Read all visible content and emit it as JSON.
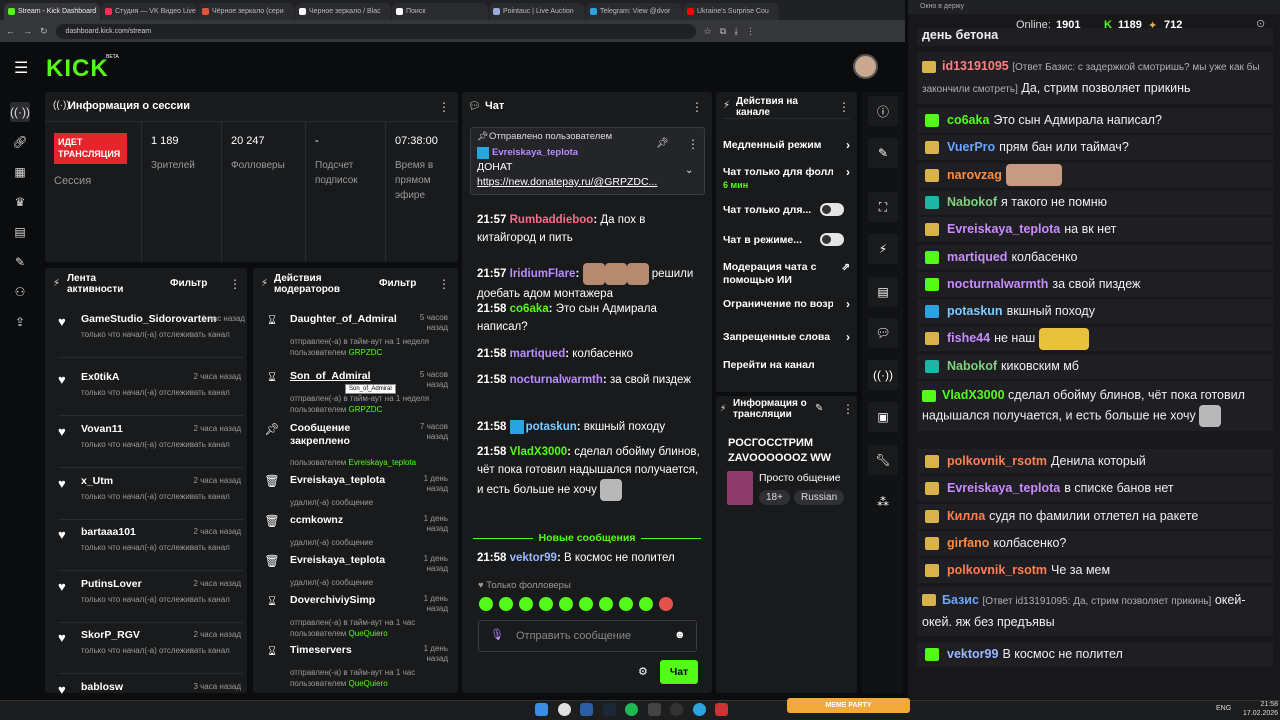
{
  "browser": {
    "tabs": [
      "Stream - Kick Dashboard",
      "Студия — VK Видео Live",
      "Чёрное зеркало (сери",
      "Черное зеркало / Blac",
      "Поиск",
      "Pointauc | Live Auction",
      "Telegram: View @dvor",
      "Ukraine's Surprise Cou"
    ],
    "url": "dashboard.kick.com/stream"
  },
  "header": {
    "logo": "KICK",
    "beta": "BETA"
  },
  "session": {
    "title": "Информация о сессии",
    "live_badge": "ИДЕТ ТРАНСЛЯЦИЯ",
    "session_label": "Сессия",
    "viewers_value": "1 189",
    "viewers_label": "Зрителей",
    "followers_value": "20 247",
    "followers_label": "Фолловеры",
    "subs_value": "-",
    "subs_label": "Подсчет подписок",
    "uptime_value": "07:38:00",
    "uptime_label": "Время в прямом эфире"
  },
  "activity": {
    "title": "Лента активности",
    "filter": "Фильтр",
    "items": [
      {
        "name": "GameStudio_Sidorovartem",
        "time": "1 час назад",
        "desc": "только что начал(-а) отслеживать канал"
      },
      {
        "name": "Ex0tikA",
        "time": "2 часа назад",
        "desc": "только что начал(-а) отслеживать канал"
      },
      {
        "name": "Vovan11",
        "time": "2 часа назад",
        "desc": "только что начал(-а) отслеживать канал"
      },
      {
        "name": "x_Utm",
        "time": "2 часа назад",
        "desc": "только что начал(-а) отслеживать канал"
      },
      {
        "name": "bartaaa101",
        "time": "2 часа назад",
        "desc": "только что начал(-а) отслеживать канал"
      },
      {
        "name": "PutinsLover",
        "time": "2 часа назад",
        "desc": "только что начал(-а) отслеживать канал"
      },
      {
        "name": "SkorP_RGV",
        "time": "2 часа назад",
        "desc": "только что начал(-а) отслеживать канал"
      },
      {
        "name": "bablosw",
        "time": "3 часа назад",
        "desc": ""
      }
    ]
  },
  "mod": {
    "title": "Действия модераторов",
    "filter": "Фильтр",
    "tooltip": "Son_of_Admiral",
    "items": [
      {
        "name": "Daughter_of_Admiral",
        "time": "5 часов назад",
        "desc": "отправлен(-а) в тайм-аут на 1 неделя пользователем",
        "by": "GRPZDC"
      },
      {
        "name": "Son_of_Admiral",
        "time": "5 часов назад",
        "desc": "отправлен(-а) в тайм-аут на 1 неделя пользователем",
        "by": "GRPZDC"
      },
      {
        "name": "Сообщение закреплено",
        "time": "7 часов назад",
        "desc": "пользователем",
        "by": "Evreiskaya_teplota"
      },
      {
        "name": "Evreiskaya_teplota",
        "time": "1 день назад",
        "desc": "удалил(-а) сообщение",
        "by": ""
      },
      {
        "name": "ccmkownz",
        "time": "1 день назад",
        "desc": "удалил(-а) сообщение",
        "by": ""
      },
      {
        "name": "Evreiskaya_teplota",
        "time": "1 день назад",
        "desc": "удалил(-а) сообщение",
        "by": ""
      },
      {
        "name": "DoverchiviySimp",
        "time": "1 день назад",
        "desc": "отправлен(-а) в тайм-аут на 1 час пользователем",
        "by": "QueQuiero"
      },
      {
        "name": "Timeservers",
        "time": "1 день назад",
        "desc": "отправлен(-а) в тайм-аут на 1 час пользователем",
        "by": "QueQuiero"
      }
    ]
  },
  "chat": {
    "title": "Чат",
    "pinned_label": "Отправлено пользователем",
    "pinned_user": "Evreiskaya_teplota",
    "pinned_text": "ДОНАТ",
    "pinned_link": "https://new.donatepay.ru/@GRPZDC...",
    "new_messages": "Новые сообщения",
    "followers_only": "Только фолловеры",
    "input_placeholder": "Отправить сообщение",
    "send": "Чат",
    "messages": [
      {
        "time": "21:57",
        "user": "Rumbaddieboo",
        "color": "#ff6b8a",
        "text": "Да пох в китайгород и пить"
      },
      {
        "time": "21:57",
        "user": "IridiumFlare",
        "color": "#b98cff",
        "text": "решили доебать адом монтажера"
      },
      {
        "time": "21:58",
        "user": "со6aka",
        "color": "#53fc18",
        "text": "Это сын Адмирала написал?"
      },
      {
        "time": "21:58",
        "user": "martiqued",
        "color": "#b98cff",
        "text": "колбасенко"
      },
      {
        "time": "21:58",
        "user": "nocturnalwarmth",
        "color": "#b98cff",
        "text": "за свой пиздеж"
      },
      {
        "time": "21:58",
        "user": "potaskun",
        "color": "#7ecbff",
        "text": "вкшный походу"
      },
      {
        "time": "21:58",
        "user": "VladX3000",
        "color": "#53fc18",
        "text": "сделал обойму блинов, чёт пока готовил надышался получается, и есть больше не хочу"
      },
      {
        "time": "21:58",
        "user": "vektor99",
        "color": "#9ab8ff",
        "text": "В космос не полител"
      }
    ]
  },
  "actions": {
    "title": "Действия на канале",
    "items": [
      {
        "label": "Медленный режим"
      },
      {
        "label": "Чат только для фолл",
        "sub": "6 мин"
      },
      {
        "label": "Чат только для..."
      },
      {
        "label": "Чат в режиме..."
      },
      {
        "label": "Модерация чата с помощью ИИ"
      },
      {
        "label": "Ограничение по возр"
      },
      {
        "label": "Запрещенные слова"
      },
      {
        "label": "Перейти на канал"
      }
    ]
  },
  "stream_info": {
    "title": "Информация о трансляции",
    "stream_title": "РОСГОССТРИМ ZAVOOOOOOZ WW",
    "category": "Просто общение",
    "age": "18+",
    "language": "Russian"
  },
  "twitch": {
    "window_title": "Окно в держу",
    "online_label": "Online:",
    "online_value": "1901",
    "kick_count": "1189",
    "twitch_count": "712",
    "top_text": "день бетона",
    "messages": [
      {
        "user": "id13191095",
        "color": "#ff7f7f",
        "reply": "[Ответ Базис: с задержкой смотришь? мы уже как бы закончили смотреть]",
        "text": "Да, стрим позволяет прикинь"
      },
      {
        "user": "со6aka",
        "color": "#53fc18",
        "text": "Это сын Адмирала написал?"
      },
      {
        "user": "VuerPro",
        "color": "#6aa6ff",
        "text": "прям бан или таймач?"
      },
      {
        "user": "narovzag",
        "color": "#ff8c3a",
        "text": ""
      },
      {
        "user": "Nabokof",
        "color": "#7fd27f",
        "text": "я такого не помню"
      },
      {
        "user": "Evreiskaya_teplota",
        "color": "#c98cff",
        "text": "на вк нет"
      },
      {
        "user": "martiqued",
        "color": "#c98cff",
        "text": "колбасенко"
      },
      {
        "user": "nocturnalwarmth",
        "color": "#c98cff",
        "text": "за свой пиздеж"
      },
      {
        "user": "potaskun",
        "color": "#7ecbff",
        "text": "вкшный походу"
      },
      {
        "user": "fishe44",
        "color": "#c98cff",
        "text": "не наш"
      },
      {
        "user": "Nabokof",
        "color": "#7fd27f",
        "text": "киковским мб"
      },
      {
        "user": "VladX3000",
        "color": "#53fc18",
        "text": "сделал обойму блинов, чёт пока готовил надышался получается, и есть больше не хочу"
      },
      {
        "user": "polkovnik_rsotm",
        "color": "#ff7f50",
        "text": "Денила который"
      },
      {
        "user": "Evreiskaya_teplota",
        "color": "#c98cff",
        "text": "в списке банов нет"
      },
      {
        "user": "Килла",
        "color": "#ff7f50",
        "text": "судя по фамилии отлетел на ракете"
      },
      {
        "user": "girfano",
        "color": "#ff8c3a",
        "text": "колбасенко?"
      },
      {
        "user": "polkovnik_rsotm",
        "color": "#ff7f50",
        "text": "Че за мем"
      },
      {
        "user": "Базис",
        "color": "#6aa6ff",
        "reply": "[Ответ id13191095: Да, стрим позволяет прикинь]",
        "text": "окей-окей. яж без предъявы"
      },
      {
        "user": "vektor99",
        "color": "#9ab8ff",
        "text": "В космос не полител"
      }
    ]
  },
  "taskbar": {
    "lang": "ENG",
    "time": "21:58",
    "date": "17.02.2026",
    "meme": "MEME PARTY"
  }
}
